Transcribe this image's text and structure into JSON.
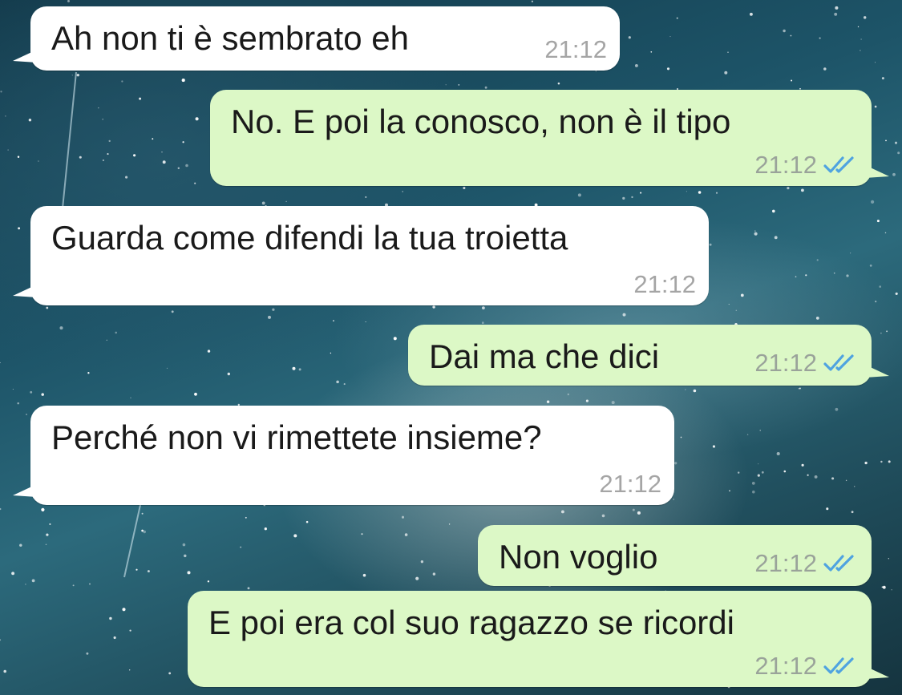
{
  "colors": {
    "incoming_bubble": "#ffffff",
    "outgoing_bubble": "#dcf8c6",
    "read_ticks": "#4fa3e0",
    "timestamp": "#9aa39a"
  },
  "messages": [
    {
      "direction": "incoming",
      "text": "Ah non ti è sembrato eh",
      "time": "21:12"
    },
    {
      "direction": "outgoing",
      "text": "No. E poi la conosco, non è il tipo",
      "time": "21:12",
      "status_icon": "double-check-read-icon"
    },
    {
      "direction": "incoming",
      "text": "Guarda come difendi la tua troietta",
      "time": "21:12"
    },
    {
      "direction": "outgoing",
      "text": "Dai ma che dici",
      "time": "21:12",
      "status_icon": "double-check-read-icon"
    },
    {
      "direction": "incoming",
      "text": "Perché non vi rimettete insieme?",
      "time": "21:12"
    },
    {
      "direction": "outgoing",
      "text": "Non voglio",
      "time": "21:12",
      "status_icon": "double-check-read-icon"
    },
    {
      "direction": "outgoing",
      "text": "E poi era col suo ragazzo se ricordi",
      "time": "21:12",
      "status_icon": "double-check-read-icon"
    }
  ]
}
